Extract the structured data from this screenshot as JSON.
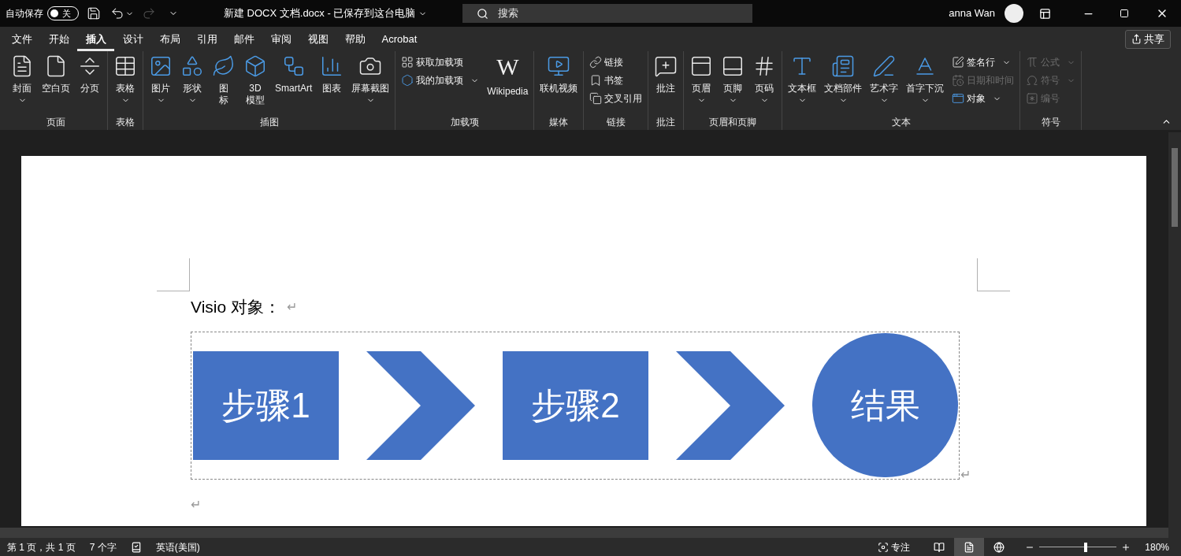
{
  "title_bar": {
    "autosave_label": "自动保存",
    "autosave": {
      "on": false,
      "label": "关"
    },
    "document_title": "新建 DOCX 文档.docx - 已保存到这台电脑",
    "search": {
      "placeholder": "搜索"
    },
    "user_name": "anna Wan"
  },
  "menu_tabs": [
    {
      "label": "文件",
      "selected": false
    },
    {
      "label": "开始",
      "selected": false
    },
    {
      "label": "插入",
      "selected": true
    },
    {
      "label": "设计",
      "selected": false
    },
    {
      "label": "布局",
      "selected": false
    },
    {
      "label": "引用",
      "selected": false
    },
    {
      "label": "邮件",
      "selected": false
    },
    {
      "label": "审阅",
      "selected": false
    },
    {
      "label": "视图",
      "selected": false
    },
    {
      "label": "帮助",
      "selected": false
    },
    {
      "label": "Acrobat",
      "selected": false
    }
  ],
  "share_button": "共享",
  "ribbon_groups": [
    {
      "label": "页面",
      "items": [
        {
          "kind": "large",
          "lines": [
            "封面"
          ],
          "dropdown": true
        },
        {
          "kind": "large",
          "lines": [
            "空白页"
          ],
          "dropdown": false
        },
        {
          "kind": "large",
          "lines": [
            "分页"
          ],
          "dropdown": false
        }
      ]
    },
    {
      "label": "表格",
      "items": [
        {
          "kind": "large",
          "lines": [
            "表格"
          ],
          "dropdown": true
        }
      ]
    },
    {
      "label": "插图",
      "items": [
        {
          "kind": "large",
          "lines": [
            "图片"
          ],
          "dropdown": true
        },
        {
          "kind": "large",
          "lines": [
            "形状"
          ],
          "dropdown": true
        },
        {
          "kind": "large",
          "lines": [
            "图",
            "标"
          ],
          "dropdown": false
        },
        {
          "kind": "large",
          "lines": [
            "3D",
            "模型"
          ],
          "dropdown": false
        },
        {
          "kind": "large",
          "lines": [
            "SmartArt"
          ],
          "dropdown": false
        },
        {
          "kind": "large",
          "lines": [
            "图表"
          ],
          "dropdown": false
        },
        {
          "kind": "large",
          "lines": [
            "屏幕截图"
          ],
          "dropdown": true
        }
      ]
    },
    {
      "label": "加载项",
      "items": [
        {
          "kind": "stack",
          "items": [
            {
              "label": "获取加载项",
              "dropdown": false,
              "disabled": false
            },
            {
              "label": "我的加载项",
              "dropdown": true,
              "disabled": false
            }
          ]
        },
        {
          "kind": "large",
          "icon_text": "W",
          "lines": [
            "Wikipedia"
          ],
          "dropdown": false
        }
      ]
    },
    {
      "label": "媒体",
      "items": [
        {
          "kind": "large",
          "lines": [
            "联机视频"
          ],
          "dropdown": false
        }
      ]
    },
    {
      "label": "链接",
      "items": [
        {
          "kind": "stack",
          "items": [
            {
              "label": "链接",
              "dropdown": false,
              "disabled": false
            },
            {
              "label": "书签",
              "dropdown": false,
              "disabled": false
            },
            {
              "label": "交叉引用",
              "dropdown": false,
              "disabled": false
            }
          ]
        }
      ]
    },
    {
      "label": "批注",
      "items": [
        {
          "kind": "large",
          "lines": [
            "批注"
          ],
          "dropdown": false
        }
      ]
    },
    {
      "label": "页眉和页脚",
      "items": [
        {
          "kind": "large",
          "lines": [
            "页眉"
          ],
          "dropdown": true
        },
        {
          "kind": "large",
          "lines": [
            "页脚"
          ],
          "dropdown": true
        },
        {
          "kind": "large",
          "lines": [
            "页码"
          ],
          "dropdown": true
        }
      ]
    },
    {
      "label": "文本",
      "items": [
        {
          "kind": "large",
          "lines": [
            "文本框"
          ],
          "dropdown": true
        },
        {
          "kind": "large",
          "lines": [
            "文档部件"
          ],
          "dropdown": true
        },
        {
          "kind": "large",
          "lines": [
            "艺术字"
          ],
          "dropdown": true
        },
        {
          "kind": "large",
          "lines": [
            "首字下沉"
          ],
          "dropdown": true
        },
        {
          "kind": "stack",
          "items": [
            {
              "label": "签名行",
              "dropdown": true,
              "disabled": false
            },
            {
              "label": "日期和时间",
              "dropdown": false,
              "disabled": true
            },
            {
              "label": "对象",
              "dropdown": true,
              "disabled": false
            }
          ]
        }
      ]
    },
    {
      "label": "符号",
      "items": [
        {
          "kind": "stack",
          "items": [
            {
              "label": "公式",
              "dropdown": true,
              "disabled": true
            },
            {
              "label": "符号",
              "dropdown": true,
              "disabled": true
            },
            {
              "label": "编号",
              "dropdown": false,
              "disabled": true
            }
          ]
        }
      ]
    }
  ],
  "document": {
    "heading": "Visio 对象：",
    "paragraph_mark": "↵",
    "diagram": [
      {
        "kind": "rect",
        "text": "步骤1"
      },
      {
        "kind": "chevron"
      },
      {
        "kind": "rect",
        "text": "步骤2"
      },
      {
        "kind": "chevron"
      },
      {
        "kind": "circle",
        "text": "结果"
      }
    ],
    "diagram_mark": "↵",
    "empty_paragraph_mark": "↵"
  },
  "status_bar": {
    "page": "第 1 页，共 1 页",
    "word_count": "7 个字",
    "language": "英语(美国)",
    "focus": "专注",
    "views": [
      {
        "selected": false
      },
      {
        "selected": true
      },
      {
        "selected": false
      }
    ],
    "zoom": {
      "level": 0.6,
      "label": "180%"
    }
  }
}
